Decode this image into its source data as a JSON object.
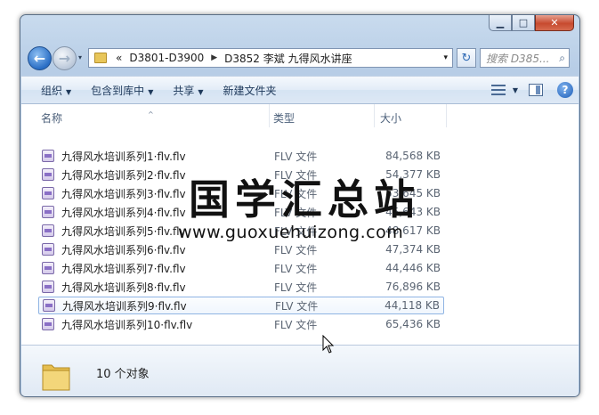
{
  "window": {
    "caption_buttons": {
      "minimize": "▁",
      "maximize": "□",
      "close": "✕"
    }
  },
  "address": {
    "history_glyph": "▾",
    "overflow": "«",
    "crumbs": [
      "D3801-D3900",
      "D3852 李斌 九得风水讲座"
    ],
    "separator": "▶",
    "dropdown": "▾",
    "refresh_glyph": "↻",
    "search_placeholder": "搜索 D385...",
    "search_icon": "magnifier-icon"
  },
  "toolbar": {
    "organize": "组织",
    "include_library": "包含到库中",
    "share": "共享",
    "new_folder": "新建文件夹",
    "dropdown_glyph": "▼",
    "help": "?"
  },
  "columns": {
    "name": "名称",
    "type": "类型",
    "size": "大小",
    "sort_glyph": "^"
  },
  "files": [
    {
      "name": "九得风水培训系列1·flv.flv",
      "type": "FLV 文件",
      "size": "84,568 KB"
    },
    {
      "name": "九得风水培训系列2·flv.flv",
      "type": "FLV 文件",
      "size": "54,377 KB"
    },
    {
      "name": "九得风水培训系列3·flv.flv",
      "type": "FLV 文件",
      "size": "53,645 KB"
    },
    {
      "name": "九得风水培训系列4·flv.flv",
      "type": "FLV 文件",
      "size": "45,643 KB"
    },
    {
      "name": "九得风水培训系列5·flv.flv",
      "type": "FLV 文件",
      "size": "48,617 KB"
    },
    {
      "name": "九得风水培训系列6·flv.flv",
      "type": "FLV 文件",
      "size": "47,374 KB"
    },
    {
      "name": "九得风水培训系列7·flv.flv",
      "type": "FLV 文件",
      "size": "44,446 KB"
    },
    {
      "name": "九得风水培训系列8·flv.flv",
      "type": "FLV 文件",
      "size": "76,896 KB"
    },
    {
      "name": "九得风水培训系列9·flv.flv",
      "type": "FLV 文件",
      "size": "44,118 KB"
    },
    {
      "name": "九得风水培训系列10·flv.flv",
      "type": "FLV 文件",
      "size": "65,436 KB"
    }
  ],
  "selected_index": 8,
  "watermark": {
    "title": "国学汇总站",
    "url": "www.guoxuehuizong.com"
  },
  "status": {
    "count": "10 个对象"
  }
}
